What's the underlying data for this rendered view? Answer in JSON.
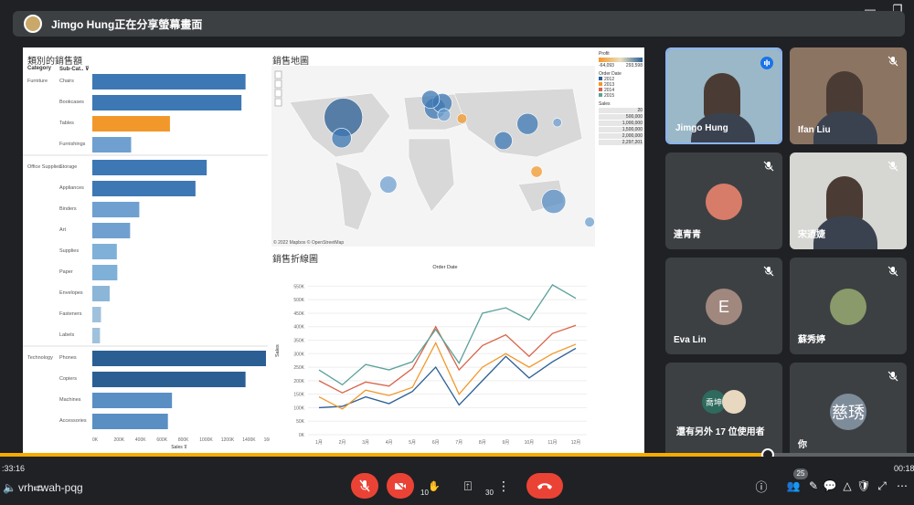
{
  "presenter": {
    "text": "Jimgo Hung正在分享螢幕畫面"
  },
  "dashboard": {
    "bar_title": "類別的銷售額",
    "col_category": "Category",
    "col_subcat": "Sub-Cat.. ⊽",
    "map_title": "銷售地圖",
    "map_credit": "© 2022 Mapbox © OpenStreetMap",
    "line_title": "銷售折線圖",
    "sales_axis": "Sales ⊽",
    "legend": {
      "profit_title": "Profit",
      "profit_min": "-64,093",
      "profit_max": "293,598",
      "order_title": "Order Date",
      "years": [
        "2012",
        "2013",
        "2014",
        "2015"
      ],
      "sales_title": "Sales",
      "sales_sizes": [
        "20",
        "500,000",
        "1,000,000",
        "1,500,000",
        "2,000,000",
        "2,297,201"
      ]
    },
    "colors": {
      "blue_dark": "#2b5f94",
      "blue": "#3d78b4",
      "blue_light": "#6fa0d0",
      "orange": "#f2982b",
      "red": "#d8644a",
      "teal": "#5ba19b"
    },
    "bar_chart": {
      "type": "bar",
      "groups": [
        {
          "category": "Furniture",
          "items": [
            {
              "label": "Chairs",
              "value": 1500000,
              "color": "#3d78b4"
            },
            {
              "label": "Bookcases",
              "value": 1460000,
              "color": "#3d78b4"
            },
            {
              "label": "Tables",
              "value": 760000,
              "color": "#f2982b"
            },
            {
              "label": "Furnishings",
              "value": 380000,
              "color": "#6fa0d0"
            }
          ]
        },
        {
          "category": "Office Supplies",
          "items": [
            {
              "label": "Storage",
              "value": 1120000,
              "color": "#3d78b4"
            },
            {
              "label": "Appliances",
              "value": 1010000,
              "color": "#3d78b4"
            },
            {
              "label": "Binders",
              "value": 460000,
              "color": "#6fa0d0"
            },
            {
              "label": "Art",
              "value": 370000,
              "color": "#6fa0d0"
            },
            {
              "label": "Supplies",
              "value": 240000,
              "color": "#7fb0d8"
            },
            {
              "label": "Paper",
              "value": 245000,
              "color": "#7fb0d8"
            },
            {
              "label": "Envelopes",
              "value": 170000,
              "color": "#8cb6d8"
            },
            {
              "label": "Fasteners",
              "value": 85000,
              "color": "#a0c1dc"
            },
            {
              "label": "Labels",
              "value": 75000,
              "color": "#a0c1dc"
            }
          ]
        },
        {
          "category": "Technology",
          "items": [
            {
              "label": "Phones",
              "value": 1700000,
              "color": "#2b5f94"
            },
            {
              "label": "Copiers",
              "value": 1500000,
              "color": "#2b5f94"
            },
            {
              "label": "Machines",
              "value": 780000,
              "color": "#5a8fc4"
            },
            {
              "label": "Accessories",
              "value": 740000,
              "color": "#5a8fc4"
            }
          ]
        }
      ],
      "xmax": 1700000,
      "xticks": [
        "0K",
        "200K",
        "400K",
        "600K",
        "800K",
        "1000K",
        "1200K",
        "1400K",
        "1600K"
      ],
      "xlabel": "Sales ⊽"
    },
    "line_chart": {
      "type": "line",
      "title": "Order Date",
      "ylabel": "Sales",
      "x": [
        "1月",
        "2月",
        "3月",
        "4月",
        "5月",
        "6月",
        "7月",
        "8月",
        "9月",
        "10月",
        "11月",
        "12月"
      ],
      "ylim": [
        0,
        575000
      ],
      "yticks": [
        "0K",
        "50K",
        "100K",
        "150K",
        "200K",
        "250K",
        "300K",
        "350K",
        "400K",
        "450K",
        "500K",
        "550K"
      ],
      "series": [
        {
          "color": "#2b5f94",
          "values": [
            100000,
            105000,
            140000,
            115000,
            160000,
            250000,
            110000,
            200000,
            290000,
            210000,
            270000,
            320000
          ]
        },
        {
          "color": "#f2982b",
          "values": [
            140000,
            95000,
            165000,
            145000,
            175000,
            340000,
            150000,
            250000,
            300000,
            250000,
            300000,
            335000
          ]
        },
        {
          "color": "#d8644a",
          "values": [
            200000,
            155000,
            195000,
            180000,
            245000,
            400000,
            240000,
            330000,
            370000,
            290000,
            375000,
            405000
          ]
        },
        {
          "color": "#5ba19b",
          "values": [
            240000,
            185000,
            260000,
            240000,
            270000,
            390000,
            265000,
            450000,
            470000,
            425000,
            555000,
            505000
          ]
        }
      ]
    },
    "map_bubbles": [
      {
        "lon": -100,
        "lat": 40,
        "size": 2297201,
        "color": "#2b5f94"
      },
      {
        "lon": -102,
        "lat": 24,
        "size": 600000,
        "color": "#3d78b4"
      },
      {
        "lon": 2,
        "lat": 47,
        "size": 700000,
        "color": "#3d78b4"
      },
      {
        "lon": 10,
        "lat": 51,
        "size": 600000,
        "color": "#3d78b4"
      },
      {
        "lon": -3,
        "lat": 54,
        "size": 500000,
        "color": "#3d78b4"
      },
      {
        "lon": 105,
        "lat": 35,
        "size": 700000,
        "color": "#3d78b4"
      },
      {
        "lon": 78,
        "lat": 22,
        "size": 500000,
        "color": "#3d78b4"
      },
      {
        "lon": 134,
        "lat": -25,
        "size": 900000,
        "color": "#5a8fc4"
      },
      {
        "lon": -50,
        "lat": -12,
        "size": 450000,
        "color": "#6fa0d0"
      },
      {
        "lon": 12,
        "lat": 42,
        "size": 250000,
        "color": "#6fa0d0"
      },
      {
        "lon": 32,
        "lat": 39,
        "size": 150000,
        "color": "#f2982b"
      },
      {
        "lon": 115,
        "lat": -2,
        "size": 200000,
        "color": "#f2982b"
      },
      {
        "lon": 174,
        "lat": -41,
        "size": 150000,
        "color": "#6fa0d0"
      },
      {
        "lon": 138,
        "lat": 36,
        "size": 120000,
        "color": "#6fa0d0"
      }
    ]
  },
  "participants": [
    {
      "name": "Jimgo Hung",
      "video": true,
      "bg": "#9bb8c8",
      "speaking": true
    },
    {
      "name": "Ifan Liu",
      "video": true,
      "bg": "#8c7462",
      "muted": true
    },
    {
      "name": "連青青",
      "avatar_color": "#d87c6a",
      "muted": true
    },
    {
      "name": "宋迺婕",
      "video": true,
      "bg": "#d6d6d2",
      "muted": true
    },
    {
      "name": "Eva Lin",
      "initial": "E",
      "avatar_color": "#a1887f",
      "muted": true
    },
    {
      "name": "蘇秀婷",
      "avatar_color": "#8a9a6a",
      "muted": true
    },
    {
      "name": "還有另外 17 位使用者",
      "mini": "喬坤"
    },
    {
      "name": "你",
      "initial": "慈琇",
      "avatar_color": "#7e8c9a",
      "muted": true
    }
  ],
  "player": {
    "time_left": ":33:16",
    "time_right": "00:18",
    "progress_pct": 84,
    "meet_code": "vrh-rwah-pqg",
    "skip_back": "10",
    "skip_fwd": "30",
    "people_count": "25"
  }
}
